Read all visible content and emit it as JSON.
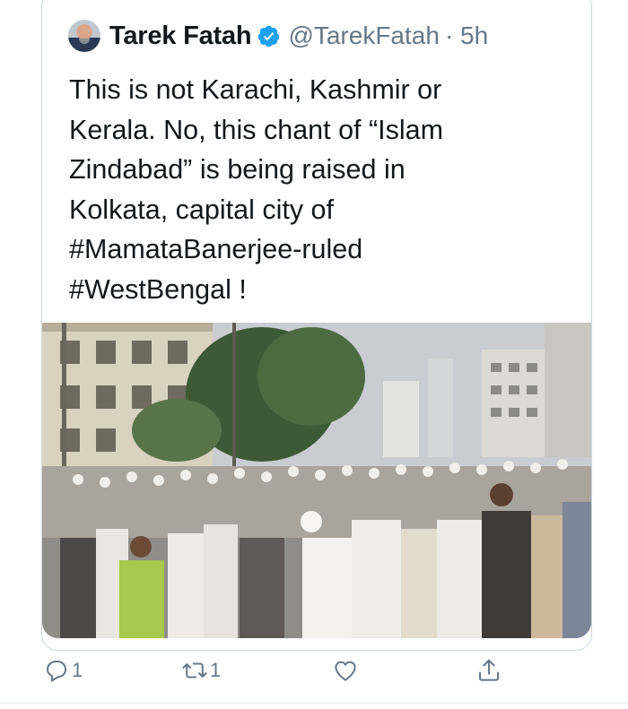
{
  "tweet": {
    "author_name": "Tarek Fatah",
    "handle": "@TarekFatah",
    "time": "· 5h",
    "verified": true,
    "text_lines": [
      "This is not Karachi, Kashmir or",
      "Kerala. No, this chant of “Islam",
      "Zindabad” is being raised in",
      "Kolkata, capital city of",
      "#MamataBanerjee-ruled",
      "#WestBengal !"
    ]
  },
  "actions": {
    "reply_count": "1",
    "retweet_count": "1",
    "like_count": "",
    "icons": [
      "reply-icon",
      "retweet-icon",
      "like-icon",
      "share-icon"
    ]
  },
  "colors": {
    "verified": "#1da1f2",
    "secondary_text": "#657786",
    "border": "#cfd9de"
  }
}
